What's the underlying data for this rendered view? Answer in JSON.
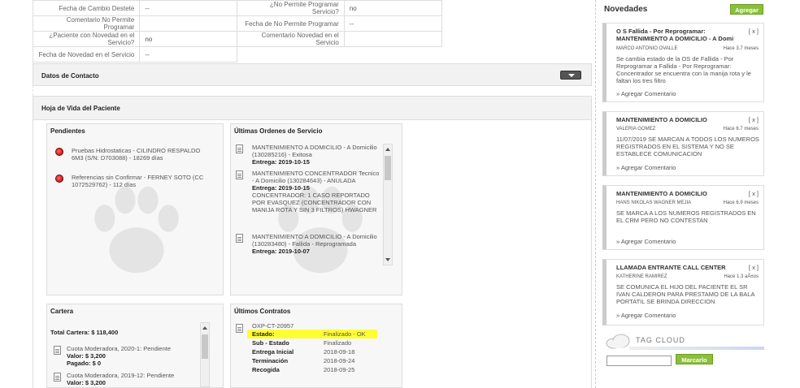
{
  "fields": [
    {
      "l1": "Fecha de Cambio Destete",
      "v1": "--",
      "l2": "¿No Permite Programar Servicio?",
      "v2": "no"
    },
    {
      "l1": "Comentario No Permite Programar",
      "v1": "",
      "l2": "Fecha de No Permite Programar",
      "v2": "--"
    },
    {
      "l1": "¿Paciente con Novedad en el Servicio?",
      "v1": "no",
      "l2": "Comentario Novedad en el Servicio",
      "v2": ""
    },
    {
      "l1": "Fecha de Novedad en el Servicio",
      "v1": "--"
    }
  ],
  "sections": {
    "contact": "Datos de Contacto",
    "life": "Hoja de Vida del Paciente"
  },
  "pendientes": {
    "title": "Pendientes",
    "items": [
      "Pruebas Hidrostaticas - CILINDRO RESPALDO 6M3 (S/N: D703088) - 18269 días",
      "Referencias sin Confirmar - FERNEY SOTO (CC 1072529762) - 112 días"
    ]
  },
  "ordenes": {
    "title": "Últimas Ordenes de Servicio",
    "items": [
      {
        "t": "MANTENIMIENTO A DOMICILIO - A Domicilio (130285216) - Exitosa",
        "e": "Entrega: 2019-10-15",
        "extra": ""
      },
      {
        "t": "MANTENIMIENTO CONCENTRADOR Tecnico - A Domicilio (130284643) - ANULADA",
        "e": "Entrega: 2019-10-15",
        "extra": "CONCENTRADOR: 1 CASO REPORTADO POR EVASQUEZ (CONCENTRADOR CON MANIJA ROTA Y SIN 3 FILTROS) HWAGNER"
      },
      {
        "t": "MANTENIMIENTO A DOMICILIO - A Domicilio (130283480) - Fallida - Reprogramada",
        "e": "Entrega: 2019-10-07",
        "extra": ""
      }
    ]
  },
  "cartera": {
    "title": "Cartera",
    "total": "Total Cartera: $ 118,400",
    "items": [
      {
        "t": "Cuota Moderadora, 2020-1: Pendiente",
        "valor": "Valor: $ 3,200",
        "pagado": "Pagado: $ 0"
      },
      {
        "t": "Cuota Moderadora, 2019-12: Pendiente",
        "valor": "Valor: $ 3,200",
        "pagado": ""
      }
    ]
  },
  "contratos": {
    "title": "Últimos Contratos",
    "code": "OXP-CT-20957",
    "rows": [
      {
        "k": "Estado:",
        "v": "Finalizado - OK"
      },
      {
        "k": "Sub - Estado",
        "v": "Finalizado"
      },
      {
        "k": "Entrega Inicial",
        "v": "2018-09-18"
      },
      {
        "k": "Terminación",
        "v": "2018-09-24"
      },
      {
        "k": "Recogida",
        "v": "2018-09-25"
      }
    ]
  },
  "novedades": {
    "title": "Novedades",
    "add_label": "Agregar",
    "close_label": "[ x ]",
    "comment_label": "» Agregar Comentario",
    "cards": [
      {
        "title": "O S Fallida - Por Reprogramar: MANTENIMIENTO A DOMICILIO - A Domi",
        "user": "MARCO ANTONIO OVALLE",
        "ago": "Hace 3.7 meses",
        "body": "Se cambia estado de la OS de Fallida - Por Reprogramar a Fallida - Por Reprogramar: Concentrador se encuentra con la manija rota y le faltan los tres filtro"
      },
      {
        "title": "MANTENIMIENTO A DOMICILIO",
        "user": "VALERIA GOMEZ",
        "ago": "Hace 6.7 meses",
        "body": "11/07/2019 SE MARCAN A TODOS LOS NUMEROS REGISTRADOS EN EL SISTEMA Y NO SE ESTABLECE COMUNICACION"
      },
      {
        "title": "MANTENIMIENTO A DOMICILIO",
        "user": "HANS NIKOLAS WAGNER MEJIA",
        "ago": "Hace 6.9 meses",
        "body": "SE MARCA A LOS NUMEROS REGISTRADOS EN EL CRM PERO NO CONTESTAN"
      },
      {
        "title": "LLAMADA ENTRANTE CALL CENTER",
        "user": "KATHERINE RAMIREZ",
        "ago": "Hace 1.3 aÃ±os",
        "body": "SE COMUNICA EL HIJO DEL PACIENTE EL SR IVAN CALDERON PARA PRESTAMO DE LA BALA PORTATIL SE BRINDA DIRECCION"
      }
    ]
  },
  "tagcloud": {
    "label": "TAG CLOUD",
    "button": "Marcarlo"
  },
  "colors": {
    "accent_green": "#8bbf3a",
    "highlight": "#ffff33",
    "pending_red": "#c00000"
  }
}
